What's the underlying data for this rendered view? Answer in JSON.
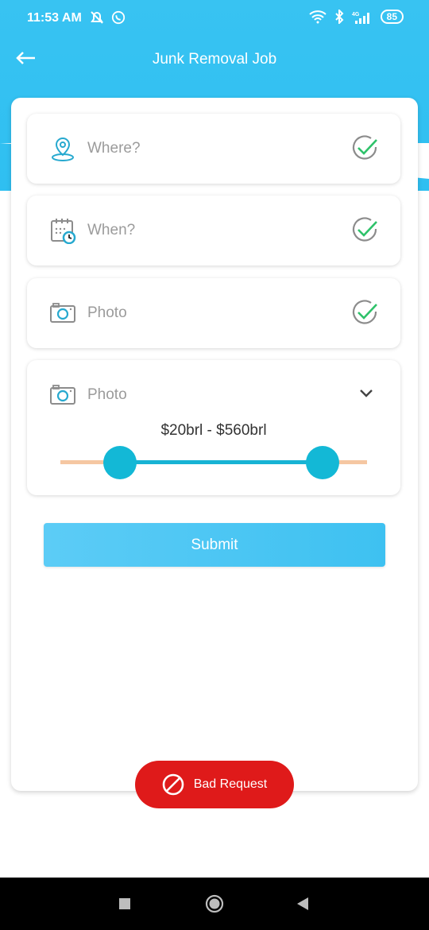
{
  "status_bar": {
    "time": "11:53 AM",
    "battery": "85",
    "network": "4G"
  },
  "appbar": {
    "title": "Junk Removal Job"
  },
  "fields": [
    {
      "label": "Where?",
      "icon": "location-pin-icon",
      "checked": true
    },
    {
      "label": "When?",
      "icon": "calendar-clock-icon",
      "checked": true
    },
    {
      "label": "Photo",
      "icon": "camera-icon",
      "checked": true
    },
    {
      "label": "Photo",
      "icon": "camera-icon",
      "expanded": true
    }
  ],
  "price_range": {
    "text": "$20brl - $560brl",
    "min": 20,
    "max": 560
  },
  "submit": {
    "label": "Submit"
  },
  "toast": {
    "label": "Bad Request"
  },
  "colors": {
    "primary": "#2fbff1",
    "accent_check": "#2ec26a",
    "slider": "#13b8d6",
    "error": "#df1a1a"
  }
}
